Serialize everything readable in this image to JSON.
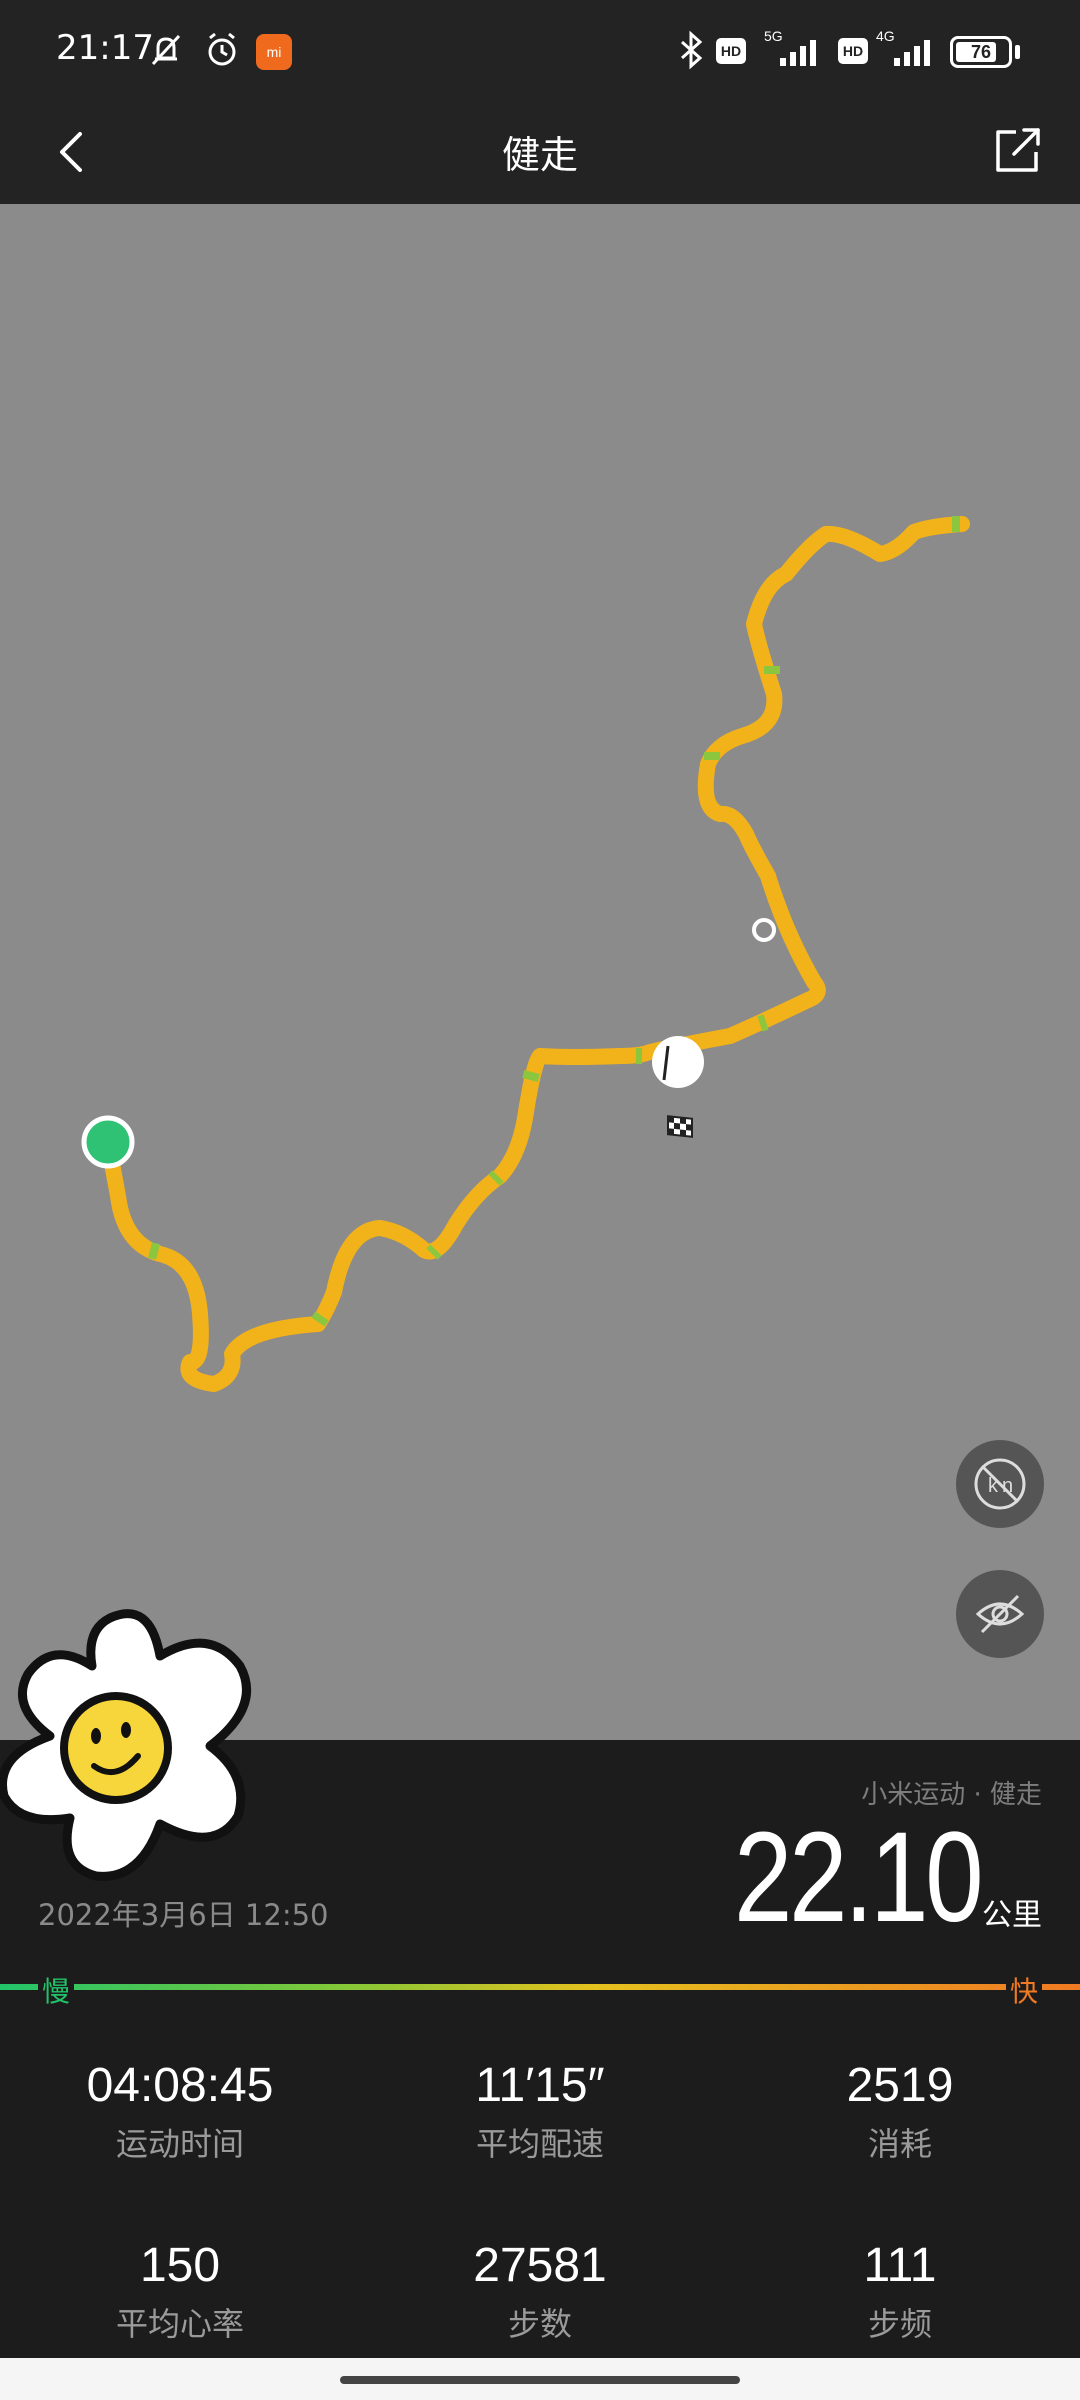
{
  "status_bar": {
    "time": "21:17",
    "network_1": "5G",
    "network_2": "4G",
    "hd": "HD",
    "battery": "76",
    "app_badge": "mi"
  },
  "header": {
    "title": "健走"
  },
  "map": {
    "route_color": "#f2b21a",
    "start_color": "#2fc275",
    "buttons": [
      "km-marker-toggle-icon",
      "hide-eye-icon"
    ]
  },
  "summary": {
    "source": "小米运动 · 健走",
    "distance": "22.10",
    "distance_unit": "公里",
    "date": "2022年3月6日 12:50"
  },
  "pace_scale": {
    "slow": "慢",
    "fast": "快"
  },
  "stats": [
    {
      "value": "04:08:45",
      "label": "运动时间"
    },
    {
      "value": "11′15″",
      "label": "平均配速"
    },
    {
      "value": "2519",
      "label": "消耗"
    },
    {
      "value": "150",
      "label": "平均心率"
    },
    {
      "value": "27581",
      "label": "步数"
    },
    {
      "value": "111",
      "label": "步频"
    }
  ]
}
